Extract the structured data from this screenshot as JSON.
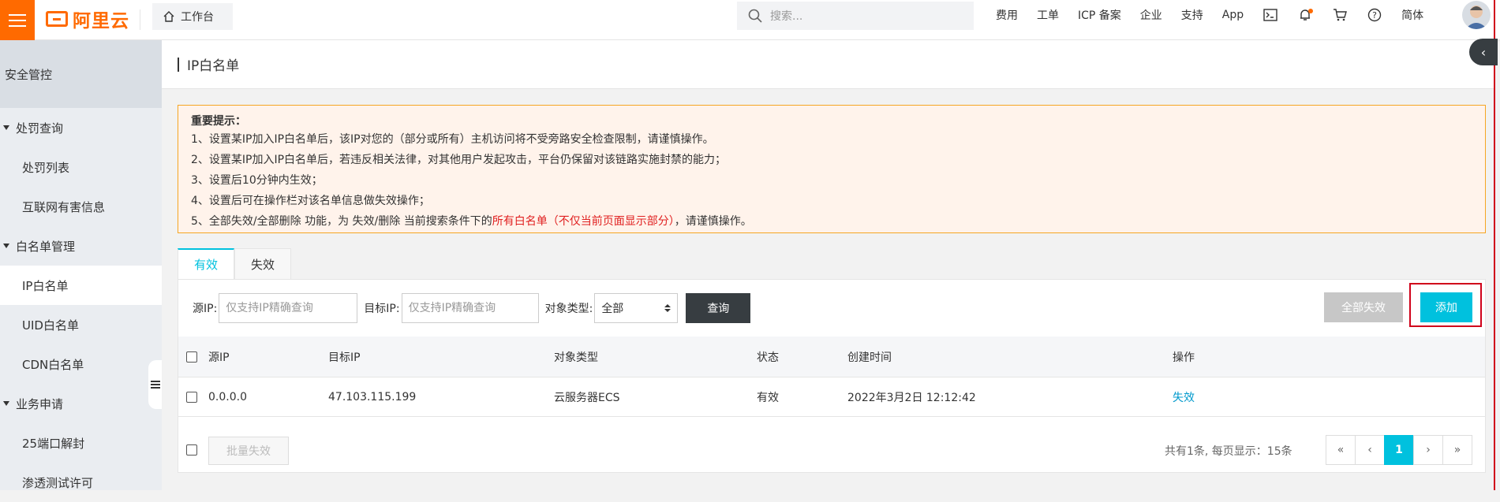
{
  "topbar": {
    "logo_text": "阿里云",
    "workbench": "工作台",
    "search_placeholder": "搜索...",
    "nav": [
      "费用",
      "工单",
      "ICP 备案",
      "企业",
      "支持",
      "App"
    ],
    "lang": "简体"
  },
  "sidebar": {
    "title": "安全管控",
    "groups": [
      {
        "label": "处罚查询",
        "items": [
          "处罚列表",
          "互联网有害信息"
        ]
      },
      {
        "label": "白名单管理",
        "items": [
          "IP白名单",
          "UID白名单",
          "CDN白名单"
        ]
      },
      {
        "label": "业务申请",
        "items": [
          "25端口解封",
          "渗透测试许可"
        ]
      }
    ]
  },
  "page": {
    "title": "IP白名单"
  },
  "notice": {
    "head": "重要提示：",
    "lines": [
      "1、设置某IP加入IP白名单后，该IP对您的（部分或所有）主机访问将不受旁路安全检查限制，请谨慎操作。",
      "2、设置某IP加入IP白名单后，若违反相关法律，对其他用户发起攻击，平台仍保留对该链路实施封禁的能力；",
      "3、设置后10分钟内生效；",
      "4、设置后可在操作栏对该名单信息做失效操作；"
    ],
    "line5_pre": "5、全部失效/全部删除 功能，为 失效/删除 当前搜索条件下的",
    "line5_red": "所有白名单（不仅当前页面显示部分）",
    "line5_post": "，请谨慎操作。"
  },
  "tabs": [
    "有效",
    "失效"
  ],
  "filters": {
    "src_label": "源IP:",
    "src_placeholder": "仅支持IP精确查询",
    "dst_label": "目标IP:",
    "dst_placeholder": "仅支持IP精确查询",
    "type_label": "对象类型:",
    "type_value": "全部",
    "query": "查询",
    "disable_all": "全部失效",
    "add": "添加"
  },
  "table": {
    "headers": [
      "源IP",
      "目标IP",
      "对象类型",
      "状态",
      "创建时间",
      "操作"
    ],
    "rows": [
      {
        "src": "0.0.0.0",
        "dst": "47.103.115.199",
        "type": "云服务器ECS",
        "status": "有效",
        "created": "2022年3月2日 12:12:42",
        "action": "失效"
      }
    ]
  },
  "footer": {
    "batch": "批量失效",
    "total": "共有1条, 每页显示：15条",
    "pager": [
      "«",
      "‹",
      "1",
      "›",
      "»"
    ]
  },
  "colors": {
    "brand": "#ff6a00",
    "accent": "#00c1de",
    "highlight_box": "#d0021b"
  }
}
